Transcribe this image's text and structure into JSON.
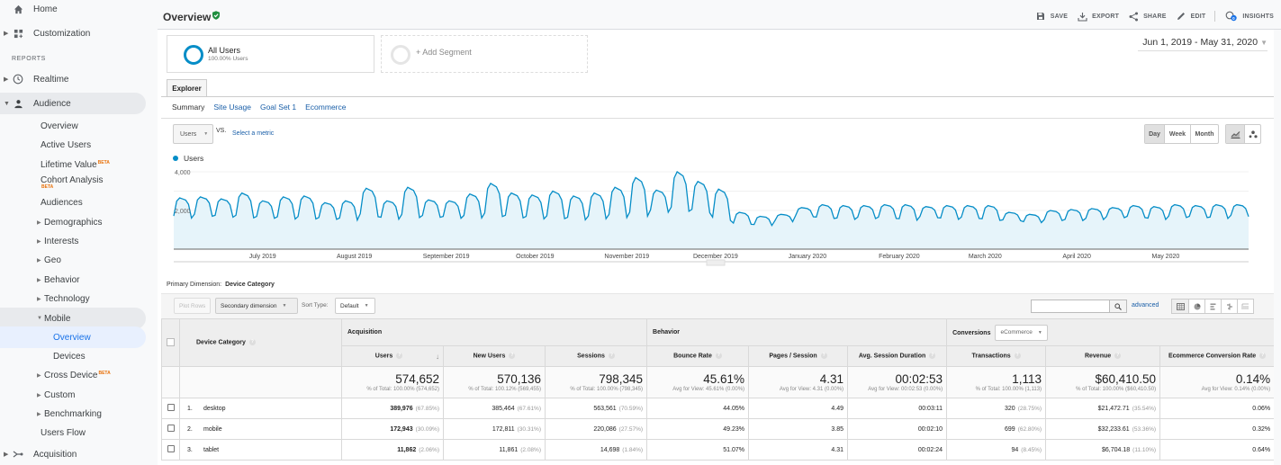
{
  "sidebar": {
    "home": "Home",
    "customization": "Customization",
    "reports_heading": "REPORTS",
    "realtime": "Realtime",
    "audience": "Audience",
    "audience_items": [
      {
        "label": "Overview"
      },
      {
        "label": "Active Users"
      },
      {
        "label": "Lifetime Value",
        "badge": "BETA"
      },
      {
        "label": "Cohort Analysis",
        "badge": "BETA"
      },
      {
        "label": "Audiences"
      },
      {
        "label": "Demographics"
      },
      {
        "label": "Interests"
      },
      {
        "label": "Geo"
      },
      {
        "label": "Behavior"
      },
      {
        "label": "Technology"
      },
      {
        "label": "Mobile"
      },
      {
        "label": "Cross Device",
        "badge": "BETA"
      },
      {
        "label": "Custom"
      },
      {
        "label": "Benchmarking"
      },
      {
        "label": "Users Flow"
      }
    ],
    "mobile_items": [
      {
        "label": "Overview"
      },
      {
        "label": "Devices"
      }
    ],
    "acquisition": "Acquisition"
  },
  "header": {
    "title": "Overview",
    "actions": {
      "save": "SAVE",
      "export": "EXPORT",
      "share": "SHARE",
      "edit": "EDIT",
      "insights": "INSIGHTS"
    }
  },
  "segments": {
    "all_users_name": "All Users",
    "all_users_sub": "100.00% Users",
    "add_segment": "+ Add Segment"
  },
  "date_range": "Jun 1, 2019 - May 31, 2020",
  "explorer": {
    "tab": "Explorer",
    "subtabs": [
      "Summary",
      "Site Usage",
      "Goal Set 1",
      "Ecommerce"
    ],
    "metric": "Users",
    "vs": "VS.",
    "select_metric": "Select a metric",
    "periods": [
      "Day",
      "Week",
      "Month"
    ],
    "active_period": "Day"
  },
  "colors": {
    "series": "#058dc7",
    "fill": "#e6f4fa",
    "link": "#1a5fa8",
    "beta": "#e8710a",
    "check": "#1e8e3e"
  },
  "chart_data": {
    "type": "area",
    "title": "",
    "legend": [
      "Users"
    ],
    "ylabel": "",
    "xlabel": "",
    "ylim": [
      0,
      4000
    ],
    "y_ticks": [
      2000,
      4000
    ],
    "y_tick_labels": [
      "2,000",
      "4,000"
    ],
    "x_tick_labels": [
      "July 2019",
      "August 2019",
      "September 2019",
      "October 2019",
      "November 2019",
      "December 2019",
      "January 2020",
      "February 2020",
      "March 2020",
      "April 2020",
      "May 2020"
    ],
    "x_range": [
      "2019-06-01",
      "2020-05-31"
    ],
    "series": [
      {
        "name": "Users",
        "weekly_peaks": [
          2650,
          2700,
          2600,
          2900,
          2500,
          2700,
          2750,
          2400,
          2500,
          3150,
          2500,
          3200,
          2550,
          2500,
          2850,
          3400,
          2900,
          2800,
          3000,
          2750,
          2900,
          3200,
          3700,
          3050,
          4000,
          3500,
          3100,
          1900,
          1700,
          1800,
          2150,
          2300,
          2250,
          2250,
          2300,
          2300,
          2200,
          2250,
          2250,
          2250,
          1900,
          1800,
          2000,
          2050,
          2100,
          2150,
          2250,
          2200,
          2300,
          2250,
          2300,
          2300
        ],
        "weekly_troughs": [
          1550,
          1650,
          1600,
          1550,
          1550,
          1500,
          1500,
          1500,
          1450,
          1600,
          1500,
          1550,
          1600,
          1550,
          1550,
          1600,
          1550,
          1500,
          1500,
          1450,
          1500,
          1550,
          1600,
          1850,
          1850,
          1800,
          1400,
          1250,
          1200,
          1400,
          1650,
          1550,
          1500,
          1550,
          1550,
          1450,
          1600,
          1500,
          1550,
          1450,
          1450,
          1350,
          1450,
          1450,
          1500,
          1600,
          1600,
          1500,
          1600,
          1600,
          1550,
          1650
        ]
      }
    ]
  },
  "table": {
    "primary_dimension_label": "Primary Dimension:",
    "primary_dimension": "Device Category",
    "plot_rows": "Plot Rows",
    "secondary_dimension": "Secondary dimension",
    "sort_type_label": "Sort Type:",
    "sort_type": "Default",
    "search_placeholder": "",
    "advanced": "advanced",
    "groups": {
      "acquisition": "Acquisition",
      "behavior": "Behavior",
      "conversions": "Conversions",
      "conversions_select": "eCommerce"
    },
    "dimension_header": "Device Category",
    "columns": [
      "Users",
      "New Users",
      "Sessions",
      "Bounce Rate",
      "Pages / Session",
      "Avg. Session Duration",
      "Transactions",
      "Revenue",
      "Ecommerce Conversion Rate"
    ],
    "totals": [
      {
        "value": "574,652",
        "sub": "% of Total: 100.00% (574,652)"
      },
      {
        "value": "570,136",
        "sub": "% of Total: 100.12% (569,455)"
      },
      {
        "value": "798,345",
        "sub": "% of Total: 100.00% (798,345)"
      },
      {
        "value": "45.61%",
        "sub": "Avg for View: 45.61% (0.00%)"
      },
      {
        "value": "4.31",
        "sub": "Avg for View: 4.31 (0.00%)"
      },
      {
        "value": "00:02:53",
        "sub": "Avg for View: 00:02:53 (0.00%)"
      },
      {
        "value": "1,113",
        "sub": "% of Total: 100.00% (1,113)"
      },
      {
        "value": "$60,410.50",
        "sub": "% of Total: 100.00% ($60,410.50)"
      },
      {
        "value": "0.14%",
        "sub": "Avg for View: 0.14% (0.00%)"
      }
    ],
    "rows": [
      {
        "num": "1.",
        "name": "desktop",
        "users": "389,976",
        "users_pct": "(67.85%)",
        "new_users": "385,464",
        "new_users_pct": "(67.61%)",
        "sessions": "563,561",
        "sessions_pct": "(70.59%)",
        "bounce": "44.05%",
        "pages": "4.49",
        "duration": "00:03:11",
        "transactions": "320",
        "transactions_pct": "(28.75%)",
        "revenue": "$21,472.71",
        "revenue_pct": "(35.54%)",
        "conv": "0.06%"
      },
      {
        "num": "2.",
        "name": "mobile",
        "users": "172,943",
        "users_pct": "(30.09%)",
        "new_users": "172,811",
        "new_users_pct": "(30.31%)",
        "sessions": "220,086",
        "sessions_pct": "(27.57%)",
        "bounce": "49.23%",
        "pages": "3.85",
        "duration": "00:02:10",
        "transactions": "699",
        "transactions_pct": "(62.80%)",
        "revenue": "$32,233.61",
        "revenue_pct": "(53.36%)",
        "conv": "0.32%"
      },
      {
        "num": "3.",
        "name": "tablet",
        "users": "11,862",
        "users_pct": "(2.06%)",
        "new_users": "11,861",
        "new_users_pct": "(2.08%)",
        "sessions": "14,698",
        "sessions_pct": "(1.84%)",
        "bounce": "51.07%",
        "pages": "4.31",
        "duration": "00:02:24",
        "transactions": "94",
        "transactions_pct": "(8.45%)",
        "revenue": "$6,704.18",
        "revenue_pct": "(11.10%)",
        "conv": "0.64%"
      }
    ]
  }
}
